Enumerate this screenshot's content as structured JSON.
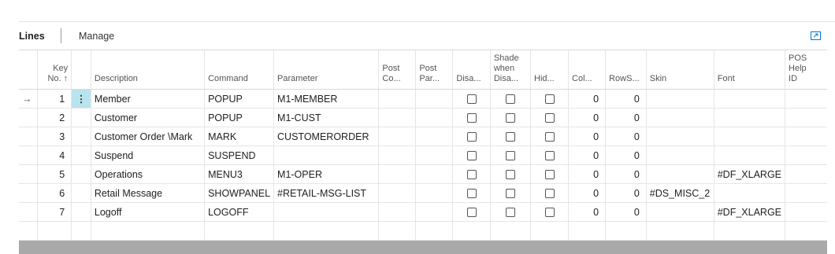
{
  "tabs": {
    "lines_label": "Lines",
    "manage_label": "Manage"
  },
  "columns": {
    "key_no": [
      "Key",
      "No. ↑"
    ],
    "description": "Description",
    "command": "Command",
    "parameter": "Parameter",
    "post_co": [
      "Post",
      "Co..."
    ],
    "post_par": [
      "Post",
      "Par..."
    ],
    "disa": "Disa...",
    "shade": [
      "Shade",
      "when",
      "Disa..."
    ],
    "hid": "Hid...",
    "col": "Col...",
    "rows": "RowS...",
    "skin": "Skin",
    "font": "Font",
    "pos_help": [
      "POS",
      "Help",
      "ID"
    ]
  },
  "rows": [
    {
      "key": "1",
      "description": "Member",
      "command": "POPUP",
      "parameter": "M1-MEMBER",
      "col": "0",
      "rows": "0",
      "skin": "",
      "font": "",
      "current": true
    },
    {
      "key": "2",
      "description": "Customer",
      "command": "POPUP",
      "parameter": "M1-CUST",
      "col": "0",
      "rows": "0",
      "skin": "",
      "font": ""
    },
    {
      "key": "3",
      "description": "Customer Order \\Mark",
      "command": "MARK",
      "parameter": "CUSTOMERORDER",
      "col": "0",
      "rows": "0",
      "skin": "",
      "font": ""
    },
    {
      "key": "4",
      "description": "Suspend",
      "command": "SUSPEND",
      "parameter": "",
      "col": "0",
      "rows": "0",
      "skin": "",
      "font": ""
    },
    {
      "key": "5",
      "description": "Operations",
      "command": "MENU3",
      "parameter": "M1-OPER",
      "col": "0",
      "rows": "0",
      "skin": "",
      "font": "#DF_XLARGE"
    },
    {
      "key": "6",
      "description": "Retail Message",
      "command": "SHOWPANEL",
      "parameter": "#RETAIL-MSG-LIST",
      "col": "0",
      "rows": "0",
      "skin": "#DS_MISC_2",
      "font": ""
    },
    {
      "key": "7",
      "description": "Logoff",
      "command": "LOGOFF",
      "parameter": "",
      "col": "0",
      "rows": "0",
      "skin": "",
      "font": "#DF_XLARGE"
    }
  ],
  "icons": {
    "row_indicator": "→",
    "row_menu": "⋮",
    "expand": "expand-icon"
  },
  "colors": {
    "accent": "#0078d4",
    "selected_cell": "#b9e4ee"
  }
}
